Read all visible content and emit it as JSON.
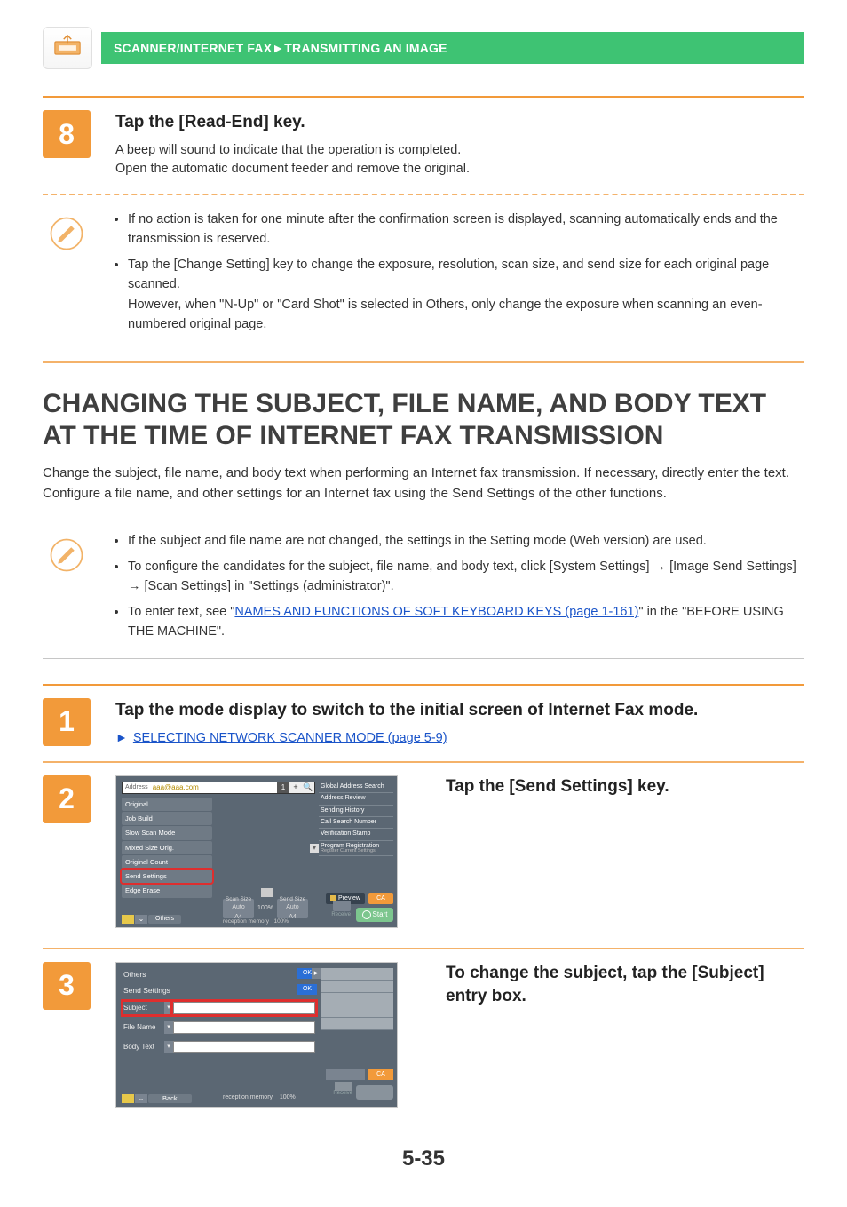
{
  "topbar": {
    "breadcrumb": "SCANNER/INTERNET FAX►TRANSMITTING AN IMAGE"
  },
  "step8": {
    "num": "8",
    "title": "Tap the [Read-End] key.",
    "line1": "A beep will sound to indicate that the operation is completed.",
    "line2": "Open the automatic document feeder and remove the original.",
    "note1": "If no action is taken for one minute after the confirmation screen is displayed, scanning automatically ends and the transmission is reserved.",
    "note2a": "Tap the [Change Setting] key to change the exposure, resolution, scan size, and send size for each original page scanned.",
    "note2b": "However, when \"N-Up\" or \"Card Shot\" is selected in Others, only change the exposure when scanning an even-numbered original page."
  },
  "mainHeading": "CHANGING THE SUBJECT, FILE NAME, AND BODY TEXT AT THE TIME OF INTERNET FAX TRANSMISSION",
  "mainPara": "Change the subject, file name, and body text when performing an Internet fax transmission. If necessary, directly enter the text. Configure a file name, and other settings for an Internet fax using the Send Settings of the other functions.",
  "infoBox": {
    "b1": "If the subject and file name are not changed, the settings in the Setting mode (Web version) are used.",
    "b2": "To configure the candidates for the subject, file name, and body text, click [System Settings] → [Image Send Settings] → [Scan Settings]  in \"Settings (administrator)\".",
    "b3a": "To enter text, see \"",
    "b3link": "NAMES AND FUNCTIONS OF SOFT KEYBOARD KEYS (page 1-161)",
    "b3b": "\" in the \"BEFORE USING THE MACHINE\"."
  },
  "step1": {
    "num": "1",
    "title": "Tap the mode display to switch to the initial screen of Internet Fax mode.",
    "linkLabel": "SELECTING NETWORK SCANNER MODE (page 5-9)"
  },
  "step2": {
    "num": "2",
    "title": "Tap the [Send Settings] key.",
    "screen": {
      "addressLabel": "Address",
      "addressValue": "aaa@aaa.com",
      "num1": "1",
      "plus": "+",
      "search": "🔍",
      "sideItems": [
        "Original",
        "Job Build",
        "Slow Scan Mode",
        "Mixed Size Orig.",
        "Original Count",
        "Send Settings",
        "Edge Erase"
      ],
      "others": "Others",
      "rightItems": [
        "Global Address Search",
        "Address Review",
        "Sending History",
        "Call Search Number",
        "Verification Stamp",
        "Program Registration",
        "Register Current Settings"
      ],
      "preview": "Preview",
      "ca": "CA",
      "start": "Start",
      "receive": "Receive",
      "scanSize": "Scan Size",
      "sendSize": "Send Size",
      "auto": "Auto",
      "a4": "A4",
      "pct": "100%",
      "rm": "reception memory",
      "rmv": "100%"
    }
  },
  "step3": {
    "num": "3",
    "title": "To change the subject, tap the [Subject] entry box.",
    "screen": {
      "othersLabel": "Others",
      "sendSettings": "Send Settings",
      "ok": "OK",
      "subject": "Subject",
      "fileName": "File Name",
      "bodyText": "Body Text",
      "back": "Back",
      "ca": "CA",
      "rm": "reception memory",
      "rmv": "100%",
      "receive": "Receive"
    }
  },
  "pageNum": "5-35"
}
